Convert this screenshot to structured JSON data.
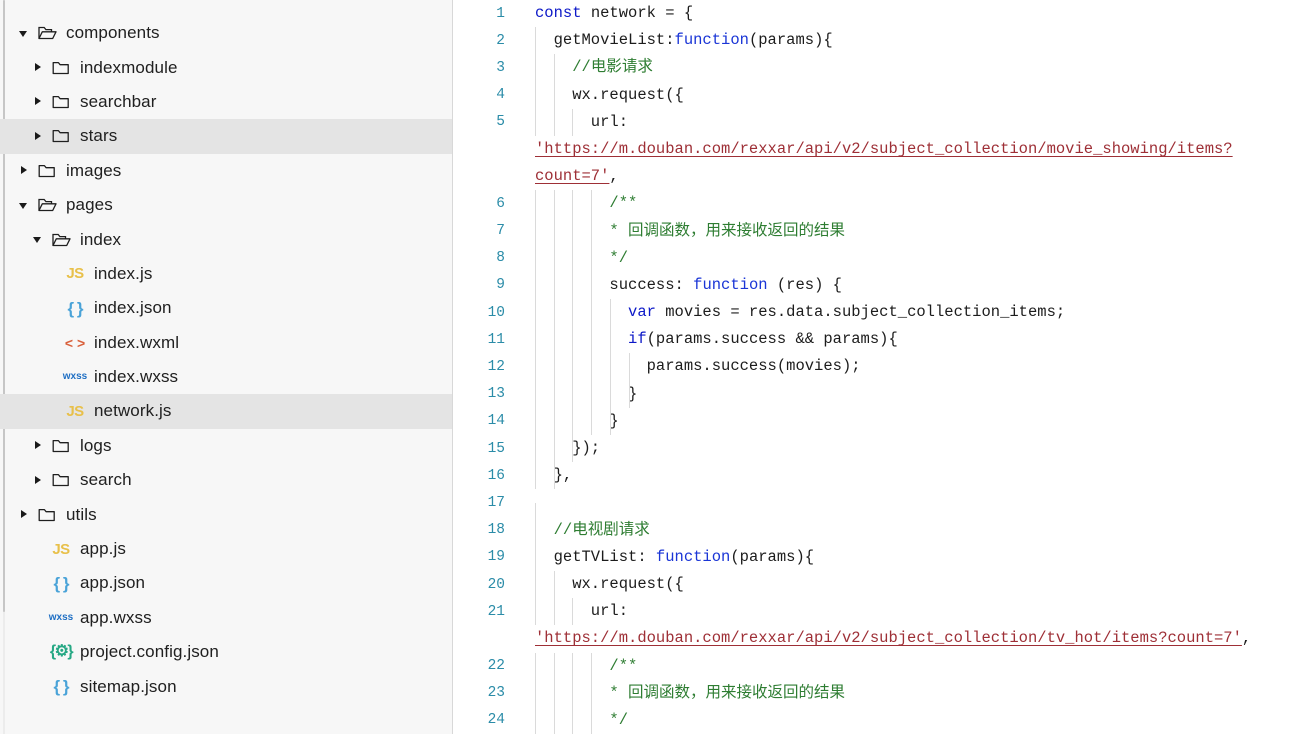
{
  "sidebar": {
    "scrollbar": "vertical-scrollbar",
    "items": [
      {
        "label": "components",
        "type": "folder-open",
        "indent": 0,
        "twisty": "open",
        "selected": false
      },
      {
        "label": "indexmodule",
        "type": "folder",
        "indent": 1,
        "twisty": "closed",
        "selected": false
      },
      {
        "label": "searchbar",
        "type": "folder",
        "indent": 1,
        "twisty": "closed",
        "selected": false
      },
      {
        "label": "stars",
        "type": "folder",
        "indent": 1,
        "twisty": "closed",
        "selected": true
      },
      {
        "label": "images",
        "type": "folder",
        "indent": 0,
        "twisty": "closed",
        "selected": false
      },
      {
        "label": "pages",
        "type": "folder-open",
        "indent": 0,
        "twisty": "open",
        "selected": false
      },
      {
        "label": "index",
        "type": "folder-open",
        "indent": 1,
        "twisty": "open",
        "selected": false
      },
      {
        "label": "index.js",
        "type": "js",
        "indent": 2,
        "twisty": "none",
        "selected": false,
        "badge": "JS"
      },
      {
        "label": "index.json",
        "type": "json",
        "indent": 2,
        "twisty": "none",
        "selected": false,
        "badge": "{ }"
      },
      {
        "label": "index.wxml",
        "type": "wxml",
        "indent": 2,
        "twisty": "none",
        "selected": false,
        "badge": "< >"
      },
      {
        "label": "index.wxss",
        "type": "wxss",
        "indent": 2,
        "twisty": "none",
        "selected": false,
        "badge": "wxss"
      },
      {
        "label": "network.js",
        "type": "js",
        "indent": 2,
        "twisty": "none",
        "selected": true,
        "badge": "JS"
      },
      {
        "label": "logs",
        "type": "folder",
        "indent": 1,
        "twisty": "closed",
        "selected": false
      },
      {
        "label": "search",
        "type": "folder",
        "indent": 1,
        "twisty": "closed",
        "selected": false
      },
      {
        "label": "utils",
        "type": "folder",
        "indent": 0,
        "twisty": "closed",
        "selected": false
      },
      {
        "label": "app.js",
        "type": "js",
        "indent": 1,
        "twisty": "none",
        "selected": false,
        "badge": "JS"
      },
      {
        "label": "app.json",
        "type": "json",
        "indent": 1,
        "twisty": "none",
        "selected": false,
        "badge": "{ }"
      },
      {
        "label": "app.wxss",
        "type": "wxss",
        "indent": 1,
        "twisty": "none",
        "selected": false,
        "badge": "wxss"
      },
      {
        "label": "project.config.json",
        "type": "cfg",
        "indent": 1,
        "twisty": "none",
        "selected": false,
        "badge": "{⚙}"
      },
      {
        "label": "sitemap.json",
        "type": "json",
        "indent": 1,
        "twisty": "none",
        "selected": false,
        "badge": "{ }"
      }
    ]
  },
  "editor": {
    "filename": "network.js",
    "first_line": 1,
    "last_line": 24,
    "lines": [
      {
        "n": 1,
        "indent": 0,
        "guides": 0,
        "tokens": [
          {
            "t": "const",
            "c": "k"
          },
          {
            "t": " network = {",
            "c": "pl"
          }
        ]
      },
      {
        "n": 2,
        "indent": 1,
        "guides": 1,
        "tokens": [
          {
            "t": "  getMovieList:",
            "c": "pl"
          },
          {
            "t": "function",
            "c": "fn"
          },
          {
            "t": "(params){",
            "c": "pl"
          }
        ]
      },
      {
        "n": 3,
        "indent": 2,
        "guides": 2,
        "tokens": [
          {
            "t": "    ",
            "c": "pl"
          },
          {
            "t": "//电影请求",
            "c": "cm"
          }
        ]
      },
      {
        "n": 4,
        "indent": 2,
        "guides": 2,
        "tokens": [
          {
            "t": "    wx.request({",
            "c": "pl"
          }
        ]
      },
      {
        "n": 5,
        "indent": 3,
        "guides": 3,
        "tokens": [
          {
            "t": "      url:",
            "c": "pl"
          }
        ]
      },
      {
        "n": null,
        "indent": 0,
        "guides": 0,
        "wrapped": true,
        "tokens": [
          {
            "t": "'https://m.douban.com/rexxar/api/v2/subject_collection/movie_showing/items?",
            "c": "str"
          }
        ]
      },
      {
        "n": null,
        "indent": 0,
        "guides": 0,
        "wrapped": true,
        "tokens": [
          {
            "t": "count=7'",
            "c": "str"
          },
          {
            "t": ",",
            "c": "pl"
          }
        ]
      },
      {
        "n": 6,
        "indent": 4,
        "guides": 4,
        "tokens": [
          {
            "t": "        ",
            "c": "pl"
          },
          {
            "t": "/**",
            "c": "cm"
          }
        ]
      },
      {
        "n": 7,
        "indent": 4,
        "guides": 4,
        "tokens": [
          {
            "t": "        ",
            "c": "pl"
          },
          {
            "t": "* 回调函数，用来接收返回的结果",
            "c": "cm"
          }
        ]
      },
      {
        "n": 8,
        "indent": 4,
        "guides": 4,
        "tokens": [
          {
            "t": "        ",
            "c": "pl"
          },
          {
            "t": "*/",
            "c": "cm"
          }
        ]
      },
      {
        "n": 9,
        "indent": 4,
        "guides": 4,
        "tokens": [
          {
            "t": "        success: ",
            "c": "pl"
          },
          {
            "t": "function",
            "c": "fn"
          },
          {
            "t": " (res) {",
            "c": "pl"
          }
        ]
      },
      {
        "n": 10,
        "indent": 5,
        "guides": 5,
        "tokens": [
          {
            "t": "          ",
            "c": "pl"
          },
          {
            "t": "var",
            "c": "k"
          },
          {
            "t": " movies = res.data.subject_collection_items;",
            "c": "pl"
          }
        ]
      },
      {
        "n": 11,
        "indent": 5,
        "guides": 5,
        "tokens": [
          {
            "t": "          ",
            "c": "pl"
          },
          {
            "t": "if",
            "c": "k"
          },
          {
            "t": "(params.success && params){",
            "c": "pl"
          }
        ]
      },
      {
        "n": 12,
        "indent": 6,
        "guides": 6,
        "tokens": [
          {
            "t": "            params.success(movies);",
            "c": "pl"
          }
        ]
      },
      {
        "n": 13,
        "indent": 5,
        "guides": 6,
        "tokens": [
          {
            "t": "          }",
            "c": "pl"
          }
        ]
      },
      {
        "n": 14,
        "indent": 4,
        "guides": 5,
        "tokens": [
          {
            "t": "        }",
            "c": "pl"
          }
        ]
      },
      {
        "n": 15,
        "indent": 3,
        "guides": 3,
        "tokens": [
          {
            "t": "    });",
            "c": "pl"
          }
        ]
      },
      {
        "n": 16,
        "indent": 1,
        "guides": 2,
        "tokens": [
          {
            "t": "  },",
            "c": "pl"
          }
        ]
      },
      {
        "n": 17,
        "indent": 1,
        "guides": 1,
        "tokens": [
          {
            "t": "",
            "c": "pl"
          }
        ]
      },
      {
        "n": 18,
        "indent": 1,
        "guides": 1,
        "tokens": [
          {
            "t": "  ",
            "c": "pl"
          },
          {
            "t": "//电视剧请求",
            "c": "cm"
          }
        ]
      },
      {
        "n": 19,
        "indent": 1,
        "guides": 1,
        "tokens": [
          {
            "t": "  getTVList: ",
            "c": "pl"
          },
          {
            "t": "function",
            "c": "fn"
          },
          {
            "t": "(params){",
            "c": "pl"
          }
        ]
      },
      {
        "n": 20,
        "indent": 2,
        "guides": 2,
        "tokens": [
          {
            "t": "    wx.request({",
            "c": "pl"
          }
        ]
      },
      {
        "n": 21,
        "indent": 3,
        "guides": 3,
        "tokens": [
          {
            "t": "      url:",
            "c": "pl"
          }
        ]
      },
      {
        "n": null,
        "indent": 0,
        "guides": 0,
        "wrapped": true,
        "tokens": [
          {
            "t": "'https://m.douban.com/rexxar/api/v2/subject_collection/tv_hot/items?count=7'",
            "c": "str"
          },
          {
            "t": ",",
            "c": "pl"
          }
        ]
      },
      {
        "n": 22,
        "indent": 4,
        "guides": 4,
        "tokens": [
          {
            "t": "        ",
            "c": "pl"
          },
          {
            "t": "/**",
            "c": "cm"
          }
        ]
      },
      {
        "n": 23,
        "indent": 4,
        "guides": 4,
        "tokens": [
          {
            "t": "        ",
            "c": "pl"
          },
          {
            "t": "* 回调函数，用来接收返回的结果",
            "c": "cm"
          }
        ]
      },
      {
        "n": 24,
        "indent": 4,
        "guides": 4,
        "tokens": [
          {
            "t": "        ",
            "c": "pl"
          },
          {
            "t": "*/",
            "c": "cm"
          }
        ]
      }
    ]
  },
  "colors": {
    "sidebar_bg": "#f7f7f7",
    "sidebar_selected": "#e4e4e4",
    "editor_bg": "#ffffff",
    "line_number": "#2b8ca8",
    "keyword": "#0d19c8",
    "comment": "#2e7d32",
    "string": "#9e2f36",
    "plain": "#1c1c1c",
    "js_icon": "#e8c04a",
    "json_icon": "#4aa3d8",
    "wxml_icon": "#d9603b",
    "wxss_icon": "#1f6fc4",
    "config_icon": "#26a884"
  }
}
